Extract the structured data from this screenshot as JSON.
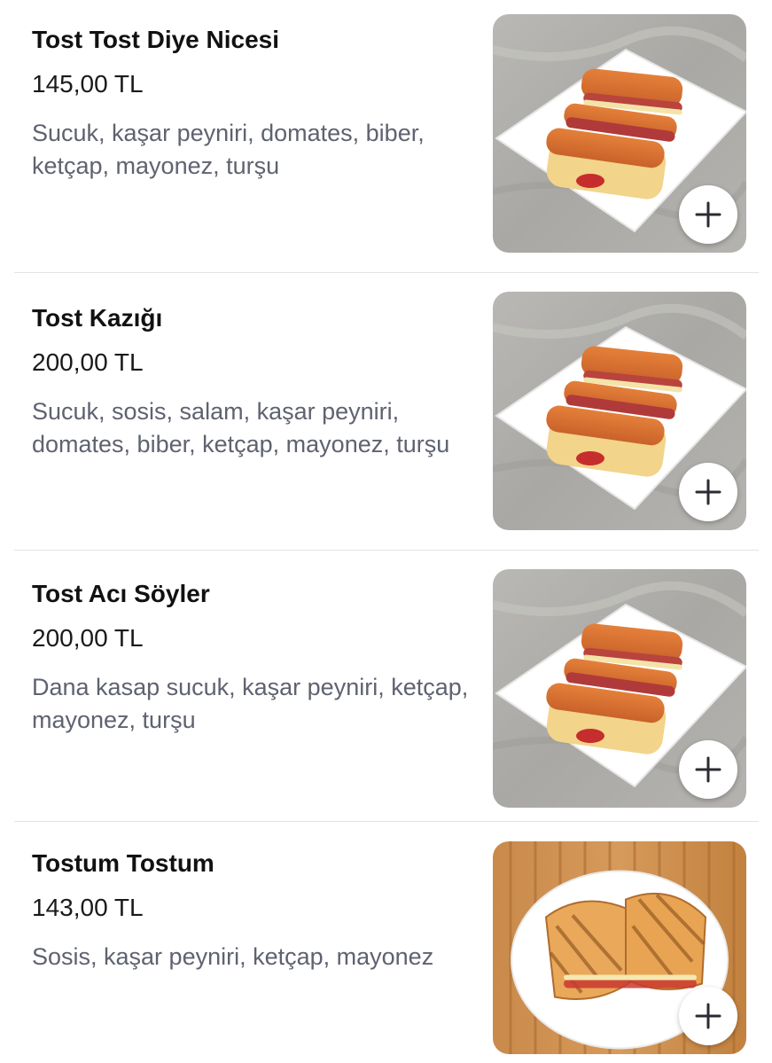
{
  "menu": {
    "items": [
      {
        "name": "Tost Tost Diye Nicesi",
        "price": "145,00 TL",
        "description": "Sucuk, kaşar peyniri, domates, biber, ketçap, mayonez, turşu",
        "image_icon": "toast-stack-on-square-plate",
        "add_icon": "plus-icon"
      },
      {
        "name": "Tost Kazığı",
        "price": "200,00 TL",
        "description": "Sucuk, sosis, salam, kaşar peyniri, domates, biber, ketçap, mayonez, turşu",
        "image_icon": "toast-stack-on-square-plate",
        "add_icon": "plus-icon"
      },
      {
        "name": "Tost Acı Söyler",
        "price": "200,00 TL",
        "description": "Dana kasap sucuk, kaşar peyniri, ketçap, mayonez, turşu",
        "image_icon": "toast-stack-on-square-plate",
        "add_icon": "plus-icon"
      },
      {
        "name": "Tostum Tostum",
        "price": "143,00 TL",
        "description": "Sosis, kaşar peyniri, ketçap, mayonez",
        "image_icon": "toast-halves-on-round-plate",
        "add_icon": "plus-icon"
      }
    ]
  },
  "colors": {
    "title": "#111111",
    "price": "#1a1a1a",
    "description": "#5f6270",
    "divider": "#e3e3e6",
    "plus": "#2b2b33"
  }
}
